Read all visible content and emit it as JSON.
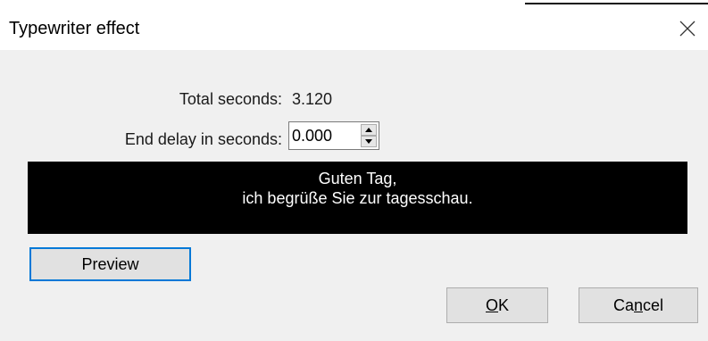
{
  "window": {
    "title": "Typewriter effect",
    "close_icon": "close-icon"
  },
  "form": {
    "total_seconds_label": "Total seconds:",
    "total_seconds_value": "3.120",
    "end_delay_label": "End delay in seconds:",
    "end_delay_value": "0.000",
    "spin_up_icon": "chevron-up-icon",
    "spin_down_icon": "chevron-down-icon"
  },
  "preview_text": {
    "line1": "Guten Tag,",
    "line2": "ich begrüße Sie zur tagesschau."
  },
  "buttons": {
    "preview": "Preview",
    "ok_mnemonic": "O",
    "ok_rest": "K",
    "cancel_pre": "Ca",
    "cancel_mnemonic": "n",
    "cancel_rest": "cel"
  },
  "colors": {
    "dialog_background": "#f0f0f0",
    "preview_background": "#000000",
    "preview_text": "#ffffff",
    "focus_border": "#0078d7"
  }
}
